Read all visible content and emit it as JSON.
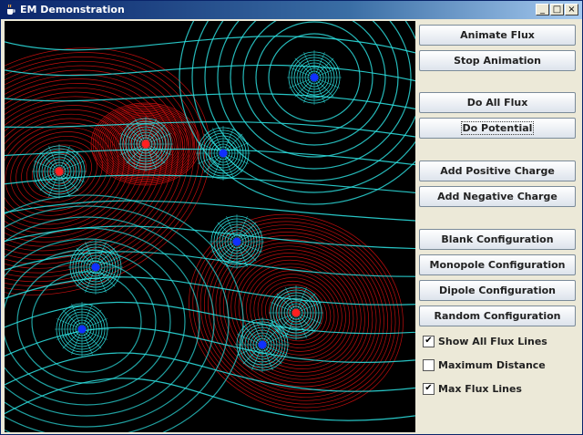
{
  "window": {
    "title": "EM Demonstration"
  },
  "controls": {
    "buttons": [
      {
        "id": "animate-flux",
        "label": "Animate Flux"
      },
      {
        "id": "stop-animation",
        "label": "Stop Animation"
      },
      {
        "id": "do-all-flux",
        "label": "Do All Flux"
      },
      {
        "id": "do-potential",
        "label": "Do Potential"
      },
      {
        "id": "add-positive",
        "label": "Add Positive Charge"
      },
      {
        "id": "add-negative",
        "label": "Add Negative Charge"
      },
      {
        "id": "blank-config",
        "label": "Blank Configuration"
      },
      {
        "id": "monopole-config",
        "label": "Monopole Configuration"
      },
      {
        "id": "dipole-config",
        "label": "Dipole Configuration"
      },
      {
        "id": "random-config",
        "label": "Random Configuration"
      }
    ],
    "checkboxes": [
      {
        "label": "Show All Flux Lines",
        "checked": true
      },
      {
        "label": "Maximum Distance",
        "checked": false
      },
      {
        "label": "Max Flux Lines",
        "checked": true
      }
    ]
  },
  "colors": {
    "flux": "#2ee6e6",
    "potential": "#e01010",
    "positive": "#ff2020",
    "negative": "#1030ff",
    "background": "#000000"
  }
}
